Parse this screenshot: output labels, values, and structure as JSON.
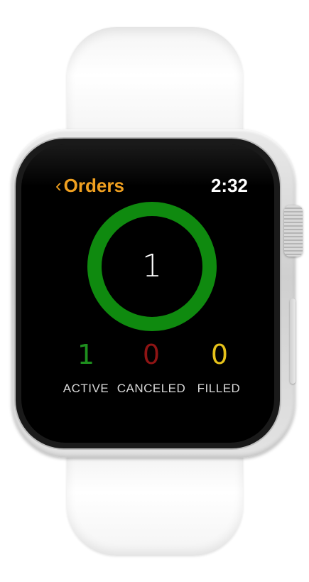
{
  "header": {
    "back_label": "Orders",
    "time": "2:32"
  },
  "ring": {
    "count": "1",
    "color": "#0f8a0f"
  },
  "stats": [
    {
      "value": "1",
      "label": "ACTIVE",
      "color": "#1e8f1e"
    },
    {
      "value": "0",
      "label": "CANCELED",
      "color": "#8f1414"
    },
    {
      "value": "0",
      "label": "FILLED",
      "color": "#e6c21a"
    }
  ],
  "colors": {
    "accent": "#f0a020",
    "background": "#000000"
  }
}
